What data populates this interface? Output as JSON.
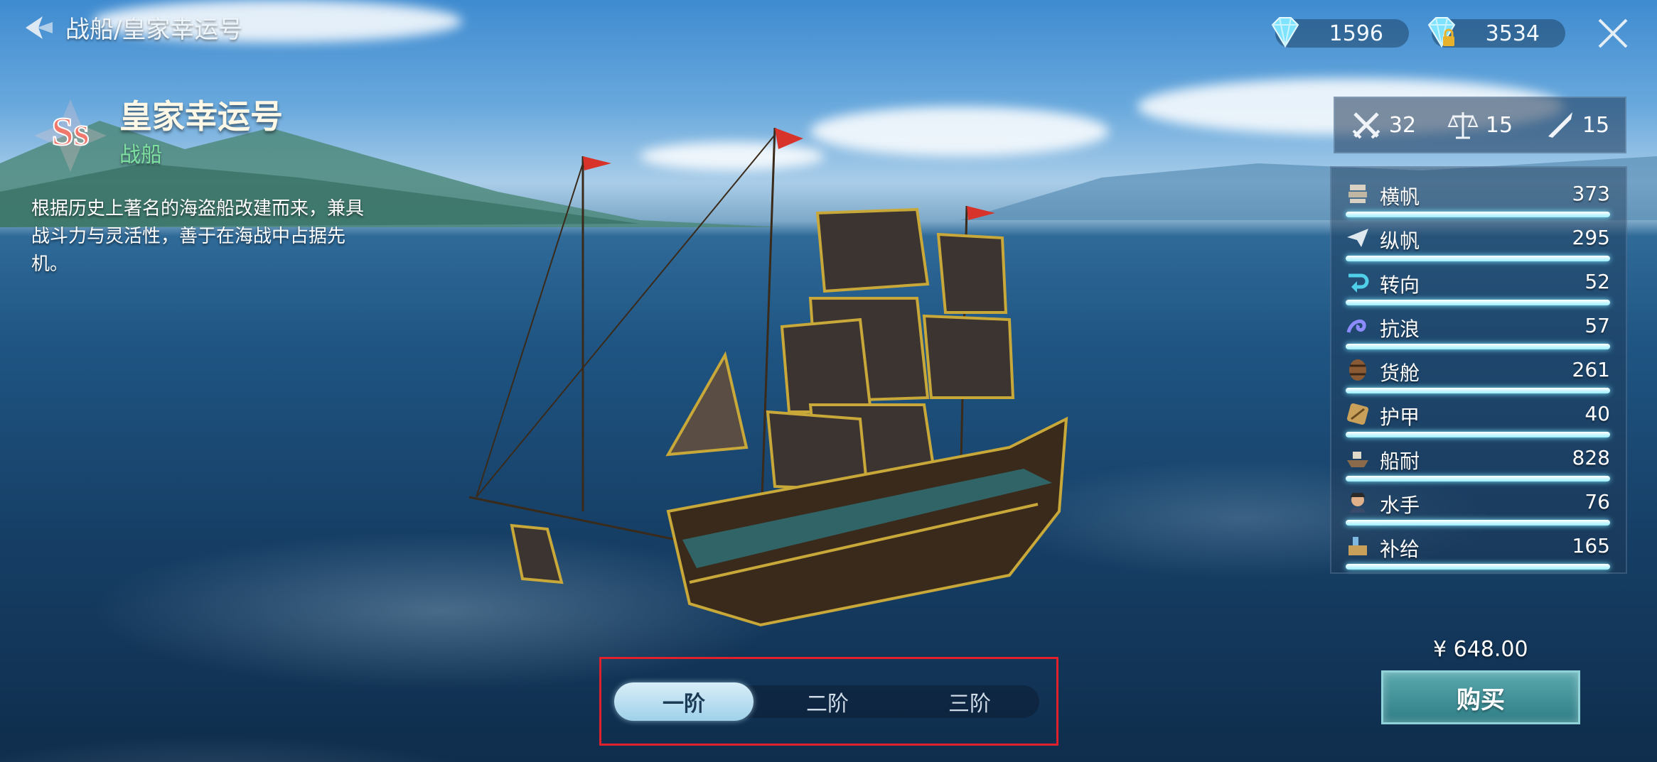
{
  "header": {
    "breadcrumb": "战船/皇家幸运号"
  },
  "currencies": [
    {
      "icon": "diamond-icon",
      "value": "1596"
    },
    {
      "icon": "locked-diamond-icon",
      "value": "3534"
    }
  ],
  "ship": {
    "rank": "Ss",
    "name": "皇家幸运号",
    "type": "战船",
    "description": "根据历史上著名的海盗船改建而来，兼具战斗力与灵活性，善于在海战中占据先机。"
  },
  "summary": [
    {
      "icon": "crossed-swords-icon",
      "value": "32"
    },
    {
      "icon": "balance-scale-icon",
      "value": "15"
    },
    {
      "icon": "quill-icon",
      "value": "15"
    }
  ],
  "attributes": [
    {
      "icon": "square-sail-icon",
      "label": "横帆",
      "value": "373",
      "fill": 1.0
    },
    {
      "icon": "paper-plane-icon",
      "label": "纵帆",
      "value": "295",
      "fill": 1.0
    },
    {
      "icon": "turn-arrow-icon",
      "label": "转向",
      "value": "52",
      "fill": 1.0
    },
    {
      "icon": "wave-icon",
      "label": "抗浪",
      "value": "57",
      "fill": 1.0
    },
    {
      "icon": "barrel-icon",
      "label": "货舱",
      "value": "261",
      "fill": 1.0
    },
    {
      "icon": "armor-plank-icon",
      "label": "护甲",
      "value": "40",
      "fill": 1.0
    },
    {
      "icon": "ship-hull-icon",
      "label": "船耐",
      "value": "828",
      "fill": 1.0
    },
    {
      "icon": "sailor-icon",
      "label": "水手",
      "value": "76",
      "fill": 1.0
    },
    {
      "icon": "supply-icon",
      "label": "补给",
      "value": "165",
      "fill": 1.0
    }
  ],
  "purchase": {
    "price": "¥ 648.00",
    "buy_label": "购买"
  },
  "tiers": {
    "items": [
      "一阶",
      "二阶",
      "三阶"
    ],
    "selected": "一阶"
  },
  "colors": {
    "type_text": "#7ee0a0",
    "bar_fill": "#9cefff",
    "buy_button": "#3f8d95",
    "highlight_border": "#e0202a"
  }
}
